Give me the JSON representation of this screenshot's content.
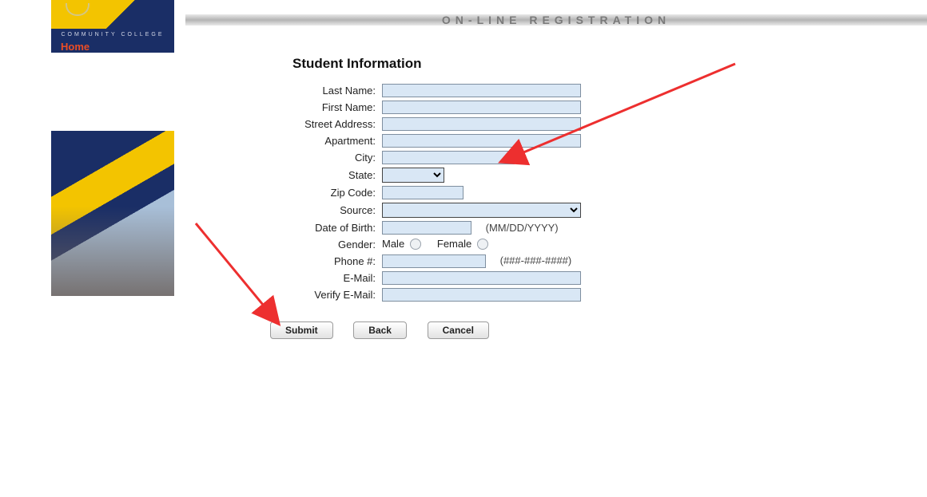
{
  "header": {
    "title": "ON-LINE REGISTRATION"
  },
  "logo": {
    "org_line": "COMMUNITY COLLEGE",
    "home_label": "Home"
  },
  "form": {
    "title": "Student Information",
    "labels": {
      "last_name": "Last Name:",
      "first_name": "First Name:",
      "street": "Street Address:",
      "apartment": "Apartment:",
      "city": "City:",
      "state": "State:",
      "zip": "Zip Code:",
      "source": "Source:",
      "dob": "Date of Birth:",
      "gender": "Gender:",
      "phone": "Phone #:",
      "email": "E-Mail:",
      "verify_email": "Verify E-Mail:"
    },
    "values": {
      "last_name": "",
      "first_name": "",
      "street": "",
      "apartment": "",
      "city": "",
      "state": "",
      "zip": "",
      "source": "",
      "dob": "",
      "phone": "",
      "email": "",
      "verify_email": ""
    },
    "hints": {
      "dob": "(MM/DD/YYYY)",
      "phone": "(###-###-####)"
    },
    "gender": {
      "male": "Male",
      "female": "Female"
    },
    "buttons": {
      "submit": "Submit",
      "back": "Back",
      "cancel": "Cancel"
    }
  }
}
